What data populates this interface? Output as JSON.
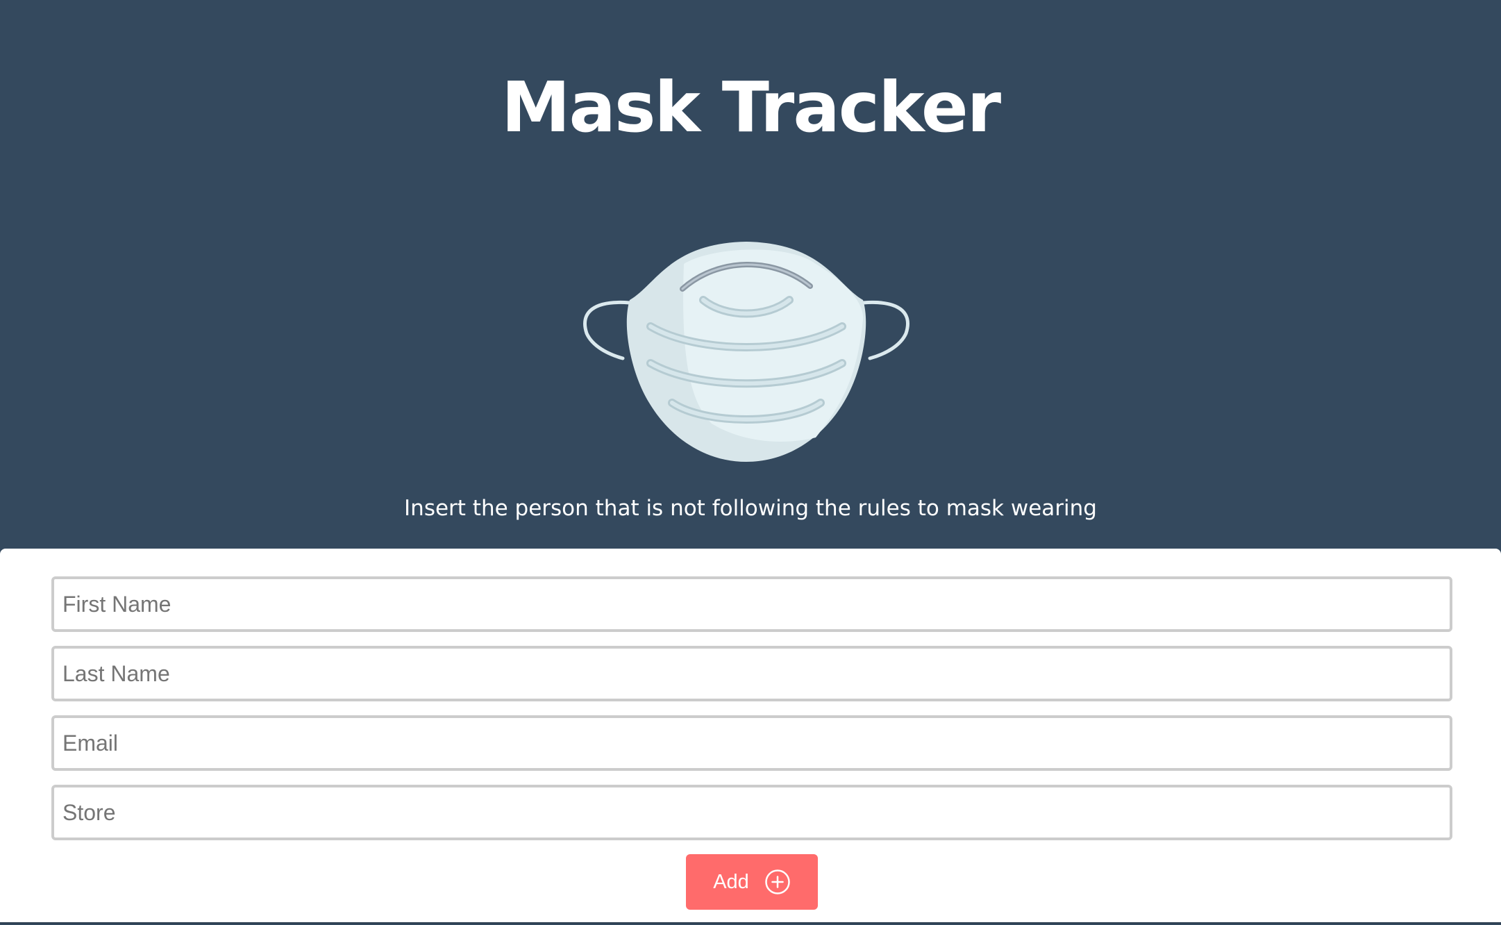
{
  "header": {
    "title": "Mask Tracker",
    "subtitle": "Insert the person that is not following the rules to mask wearing",
    "illustration": "face-mask-icon"
  },
  "form": {
    "first_name_placeholder": "First Name",
    "last_name_placeholder": "Last Name",
    "email_placeholder": "Email",
    "store_placeholder": "Store",
    "add_label": "Add",
    "add_icon": "plus-circle-icon"
  },
  "colors": {
    "header_background": "#34495e",
    "button_background": "#ff6b6b",
    "text_on_dark": "#ffffff"
  }
}
